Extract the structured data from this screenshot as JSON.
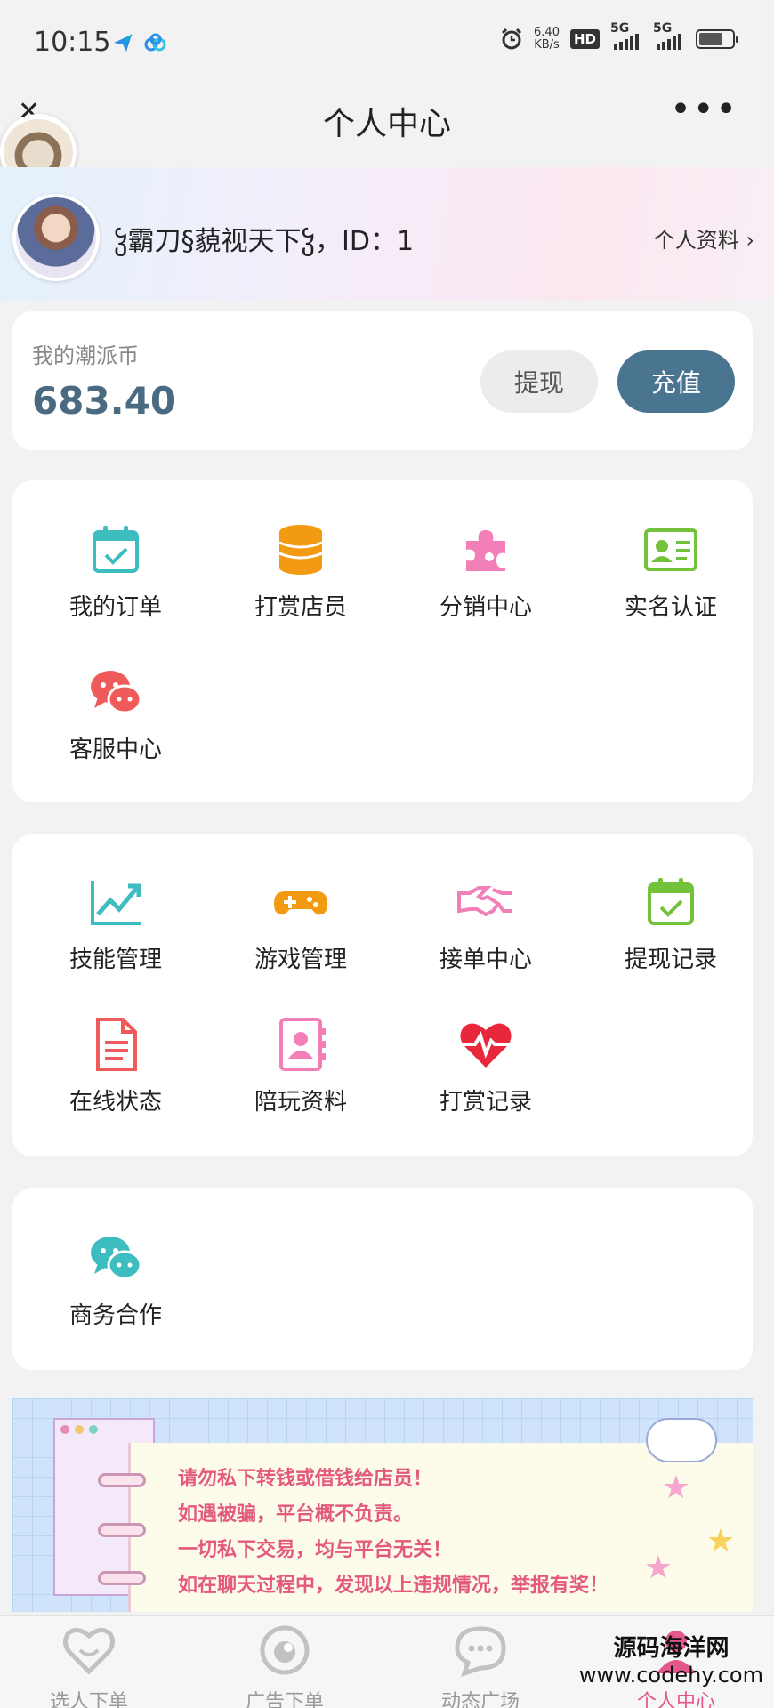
{
  "status_bar": {
    "time": "10:15",
    "net_speed": "6.40",
    "net_unit": "KB/s",
    "hd": "HD",
    "sim1": "5G",
    "sim2": "5G",
    "battery_level": 0.72
  },
  "title_bar": {
    "title": "个人中心",
    "close_icon": "close-icon",
    "more_icon": "more-icon"
  },
  "profile": {
    "name": "ჴ霸刀§藐视天下ჴ，ID：1",
    "detail_link": "个人资料 ›"
  },
  "coins": {
    "label": "我的潮派币",
    "value": "683.40",
    "withdraw": "提现",
    "recharge": "充值"
  },
  "section1": [
    {
      "label": "我的订单",
      "icon": "calendar-check-icon",
      "color": "#3dbdc0"
    },
    {
      "label": "打赏店员",
      "icon": "coin-stack-icon",
      "color": "#f39a13"
    },
    {
      "label": "分销中心",
      "icon": "puzzle-icon",
      "color": "#f37fb8"
    },
    {
      "label": "实名认证",
      "icon": "id-card-icon",
      "color": "#74c23c"
    },
    {
      "label": "客服中心",
      "icon": "chat-bubbles-icon",
      "color": "#ef5b5b"
    }
  ],
  "section2": [
    {
      "label": "技能管理",
      "icon": "trend-chart-icon",
      "color": "#3dbdc0"
    },
    {
      "label": "游戏管理",
      "icon": "gamepad-icon",
      "color": "#f39a13"
    },
    {
      "label": "接单中心",
      "icon": "handshake-icon",
      "color": "#f37fb8"
    },
    {
      "label": "提现记录",
      "icon": "calendar-check-icon",
      "color": "#74c23c"
    },
    {
      "label": "在线状态",
      "icon": "document-icon",
      "color": "#ef5b5b"
    },
    {
      "label": "陪玩资料",
      "icon": "contact-book-icon",
      "color": "#f37fb8"
    },
    {
      "label": "打赏记录",
      "icon": "heartbeat-icon",
      "color": "#e8283a"
    }
  ],
  "section3": [
    {
      "label": "商务合作",
      "icon": "chat-bubbles-icon",
      "color": "#3dbdc0"
    }
  ],
  "notice": {
    "lines": [
      "请勿私下转钱或借钱给店员！",
      "如遇被骗，平台概不负责。",
      "一切私下交易，均与平台无关！",
      "如在聊天过程中，发现以上违规情况，举报有奖！"
    ]
  },
  "tabs": [
    {
      "label": "选人下单",
      "icon": "heart-face-icon",
      "active": false
    },
    {
      "label": "广告下单",
      "icon": "eye-icon",
      "active": false
    },
    {
      "label": "动态广场",
      "icon": "chat-icon",
      "active": false
    },
    {
      "label": "个人中心",
      "icon": "profile-icon",
      "active": true
    }
  ],
  "watermark": {
    "line1": "源码海洋网",
    "line2": "www.codehy.com"
  }
}
